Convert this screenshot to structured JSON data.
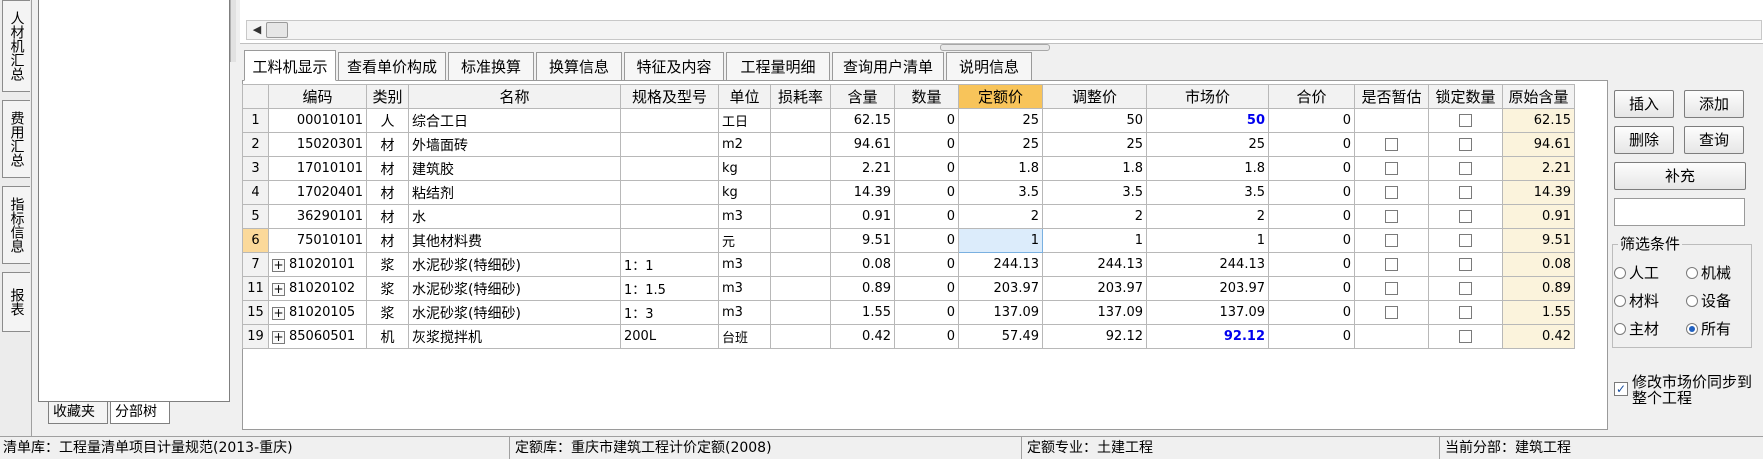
{
  "left_tabs": [
    "人材机汇总",
    "费用汇总",
    "指标信息",
    "报表"
  ],
  "tree_tabs": [
    "收藏夹",
    "分部树"
  ],
  "hscroll_left_arrow": "◀",
  "detail_tabs": [
    "工料机显示",
    "查看单价构成",
    "标准换算",
    "换算信息",
    "特征及内容",
    "工程量明细",
    "查询用户清单",
    "说明信息"
  ],
  "grid": {
    "columns": [
      "",
      "编码",
      "类别",
      "名称",
      "规格及型号",
      "单位",
      "损耗率",
      "含量",
      "数量",
      "定额价",
      "调整价",
      "市场价",
      "合价",
      "是否暂估",
      "锁定数量",
      "原始含量"
    ],
    "rows": [
      {
        "no": "1",
        "code": "00010101",
        "expand": false,
        "type": "人",
        "name": "综合工日",
        "spec": "",
        "unit": "工日",
        "loss": "",
        "qty_per": "62.15",
        "qty": "0",
        "quota": "25",
        "adjusted": "50",
        "market": "50",
        "market_blue": true,
        "total": "0",
        "est": false,
        "lock": true,
        "orig": "62.15"
      },
      {
        "no": "2",
        "code": "15020301",
        "expand": false,
        "type": "材",
        "name": "外墙面砖",
        "spec": "",
        "unit": "m2",
        "loss": "",
        "qty_per": "94.61",
        "qty": "0",
        "quota": "25",
        "adjusted": "25",
        "market": "25",
        "market_blue": false,
        "total": "0",
        "est": true,
        "lock": true,
        "orig": "94.61"
      },
      {
        "no": "3",
        "code": "17010101",
        "expand": false,
        "type": "材",
        "name": "建筑胶",
        "spec": "",
        "unit": "kg",
        "loss": "",
        "qty_per": "2.21",
        "qty": "0",
        "quota": "1.8",
        "adjusted": "1.8",
        "market": "1.8",
        "market_blue": false,
        "total": "0",
        "est": true,
        "lock": true,
        "orig": "2.21"
      },
      {
        "no": "4",
        "code": "17020401",
        "expand": false,
        "type": "材",
        "name": "粘结剂",
        "spec": "",
        "unit": "kg",
        "loss": "",
        "qty_per": "14.39",
        "qty": "0",
        "quota": "3.5",
        "adjusted": "3.5",
        "market": "3.5",
        "market_blue": false,
        "total": "0",
        "est": true,
        "lock": true,
        "orig": "14.39"
      },
      {
        "no": "5",
        "code": "36290101",
        "expand": false,
        "type": "材",
        "name": "水",
        "spec": "",
        "unit": "m3",
        "loss": "",
        "qty_per": "0.91",
        "qty": "0",
        "quota": "2",
        "adjusted": "2",
        "market": "2",
        "market_blue": false,
        "total": "0",
        "est": true,
        "lock": true,
        "orig": "0.91"
      },
      {
        "no": "6",
        "code": "75010101",
        "expand": false,
        "type": "材",
        "name": "其他材料费",
        "spec": "",
        "unit": "元",
        "loss": "",
        "qty_per": "9.51",
        "qty": "0",
        "quota": "1",
        "adjusted": "1",
        "market": "1",
        "market_blue": false,
        "total": "0",
        "est": true,
        "lock": true,
        "orig": "9.51",
        "current": true
      },
      {
        "no": "7",
        "code": "81020101",
        "expand": true,
        "type": "浆",
        "name": "水泥砂浆(特细砂)",
        "spec": "1：1",
        "unit": "m3",
        "loss": "",
        "qty_per": "0.08",
        "qty": "0",
        "quota": "244.13",
        "adjusted": "244.13",
        "market": "244.13",
        "market_blue": false,
        "total": "0",
        "est": true,
        "lock": true,
        "orig": "0.08"
      },
      {
        "no": "11",
        "code": "81020102",
        "expand": true,
        "type": "浆",
        "name": "水泥砂浆(特细砂)",
        "spec": "1：1.5",
        "unit": "m3",
        "loss": "",
        "qty_per": "0.89",
        "qty": "0",
        "quota": "203.97",
        "adjusted": "203.97",
        "market": "203.97",
        "market_blue": false,
        "total": "0",
        "est": true,
        "lock": true,
        "orig": "0.89"
      },
      {
        "no": "15",
        "code": "81020105",
        "expand": true,
        "type": "浆",
        "name": "水泥砂浆(特细砂)",
        "spec": "1：3",
        "unit": "m3",
        "loss": "",
        "qty_per": "1.55",
        "qty": "0",
        "quota": "137.09",
        "adjusted": "137.09",
        "market": "137.09",
        "market_blue": false,
        "total": "0",
        "est": true,
        "lock": true,
        "orig": "1.55"
      },
      {
        "no": "19",
        "code": "85060501",
        "expand": true,
        "type": "机",
        "name": "灰浆搅拌机",
        "spec": "200L",
        "unit": "台班",
        "loss": "",
        "qty_per": "0.42",
        "qty": "0",
        "quota": "57.49",
        "adjusted": "92.12",
        "market": "92.12",
        "market_blue": true,
        "total": "0",
        "est": false,
        "lock": true,
        "orig": "0.42"
      }
    ]
  },
  "right_panel": {
    "insert": "插入",
    "add": "添加",
    "delete": "删除",
    "query": "查询",
    "supplement": "补充",
    "filter_title": "筛选条件",
    "filters": [
      {
        "label": "人工",
        "checked": false
      },
      {
        "label": "机械",
        "checked": false
      },
      {
        "label": "材料",
        "checked": false
      },
      {
        "label": "设备",
        "checked": false
      },
      {
        "label": "主材",
        "checked": false
      },
      {
        "label": "所有",
        "checked": true
      }
    ],
    "sync_label": "修改市场价同步到整个工程",
    "sync_checked": true,
    "sync_mark": "✓"
  },
  "status": {
    "bill_lib": "清单库：工程量清单项目计量规范(2013-重庆)",
    "quota_lib": "定额库：重庆市建筑工程计价定额(2008)",
    "quota_major": "定额专业：土建工程",
    "current_part": "当前分部：建筑工程"
  },
  "colors": {
    "header_highlight": "#f8c45a",
    "market_blue": "#0000ee",
    "orig_col_bg": "#fbf3dc"
  }
}
